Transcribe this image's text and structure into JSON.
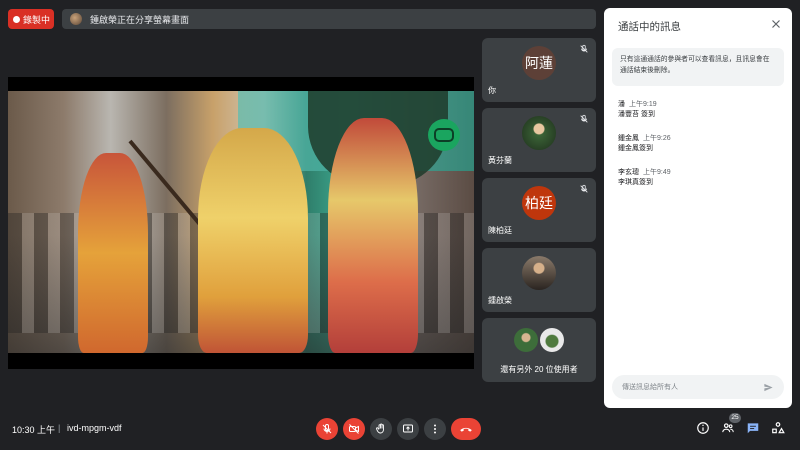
{
  "recording": {
    "label": "錄製中"
  },
  "share_banner": {
    "text": "鍾啟榮正在分享螢幕畫面"
  },
  "participants": [
    {
      "name": "你",
      "avatar_text": "阿蓮",
      "avatar_color": "#5d4037",
      "muted": false
    },
    {
      "name": "黃芬蘭",
      "avatar_text": "",
      "muted": true
    },
    {
      "name": "陳柏廷",
      "avatar_text": "柏廷",
      "avatar_color": "#bf360c",
      "muted": true
    },
    {
      "name": "鍾啟榮",
      "avatar_text": "",
      "muted": false
    }
  ],
  "others_tile": {
    "label": "還有另外 20 位使用者"
  },
  "chat": {
    "title": "通話中的訊息",
    "note": "只有這通通話的參與者可以查看訊息，且訊息會在通話結束後刪除。",
    "messages": [
      {
        "sender": "潘",
        "time": "上午9:19",
        "text": "潘豐苔 簽到"
      },
      {
        "sender": "鍾金鳳",
        "time": "上午9:26",
        "text": "鍾金鳳簽到"
      },
      {
        "sender": "李玄璁",
        "time": "上午9:49",
        "text": "李琪真簽到"
      }
    ],
    "input_placeholder": "傳送訊息給所有人"
  },
  "footer": {
    "time": "10:30 上午",
    "separator": "|",
    "meeting_code": "ivd-mpgm-vdf"
  },
  "people_count": "25",
  "colors": {
    "accent_red": "#ea4335",
    "panel_bg": "#3c4043",
    "page_bg": "#202124",
    "chat_active": "#8ab4f8"
  },
  "icons": {
    "mic_off": "mic-off-icon",
    "cam_off": "camera-off-icon",
    "hand": "raise-hand-icon",
    "present": "present-screen-icon",
    "more": "more-options-icon",
    "end": "end-call-icon",
    "info": "info-icon",
    "people": "people-icon",
    "chat": "chat-icon",
    "activities": "activities-icon"
  }
}
